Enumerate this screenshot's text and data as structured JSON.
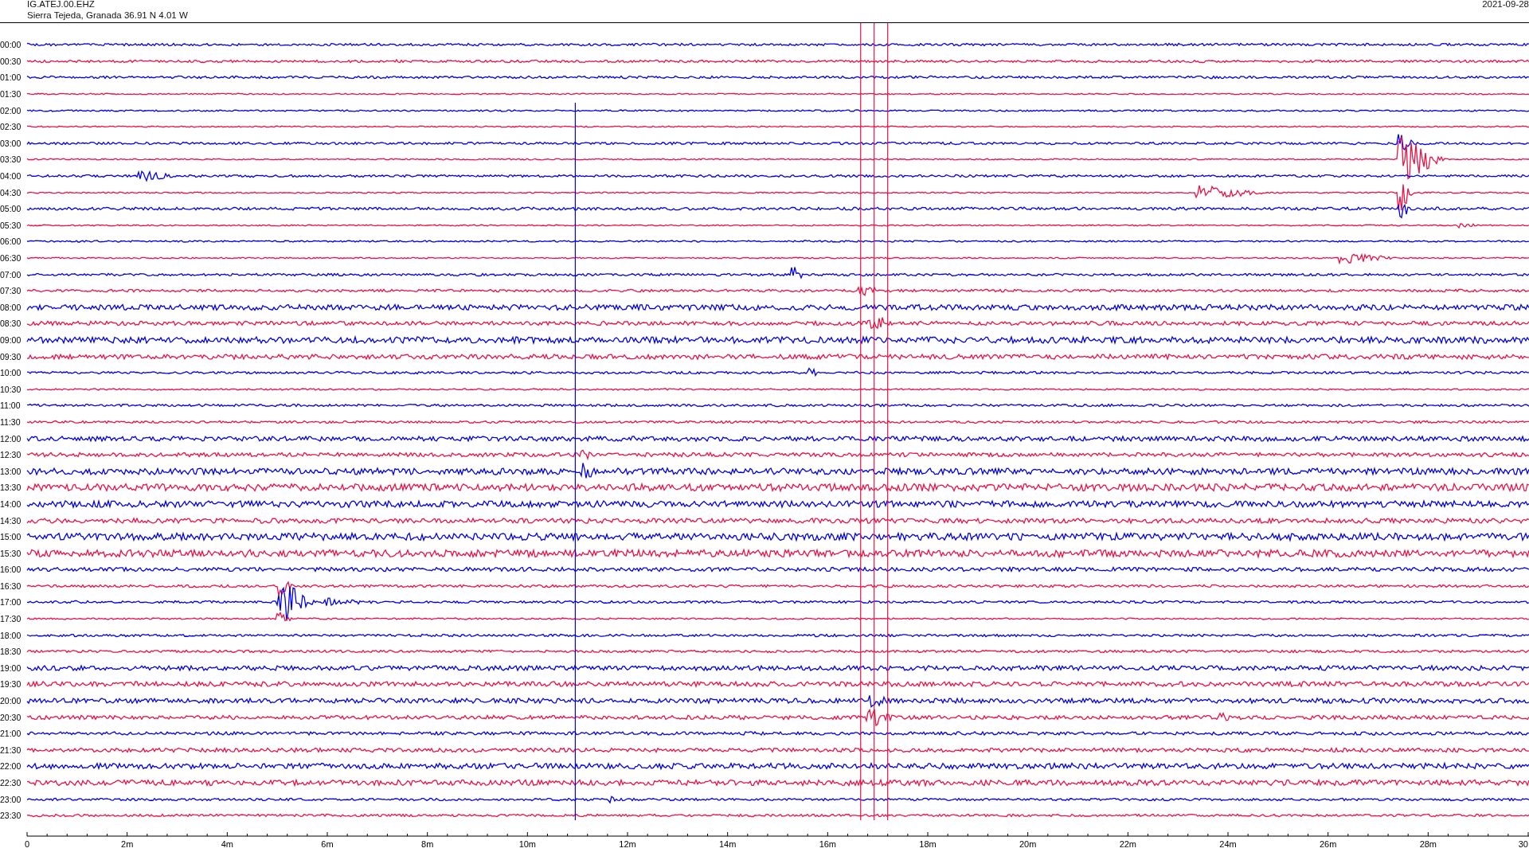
{
  "header": {
    "station": "IG.ATEJ.00.EHZ",
    "location": "Sierra Tejeda, Granada  36.91 N 4.01 W",
    "date": "2021-09-28"
  },
  "rows": [
    {
      "label": "00:00",
      "color": "#0000ee"
    },
    {
      "label": "00:30",
      "color": "#ee1144"
    },
    {
      "label": "01:00",
      "color": "#0000ee"
    },
    {
      "label": "01:30",
      "color": "#ee1144"
    },
    {
      "label": "02:00",
      "color": "#0000ee"
    },
    {
      "label": "02:30",
      "color": "#ee1144"
    },
    {
      "label": "03:00",
      "color": "#0000ee"
    },
    {
      "label": "03:30",
      "color": "#ee1144"
    },
    {
      "label": "04:00",
      "color": "#0000ee"
    },
    {
      "label": "04:30",
      "color": "#ee1144"
    },
    {
      "label": "05:00",
      "color": "#0000ee"
    },
    {
      "label": "05:30",
      "color": "#ee1144"
    },
    {
      "label": "06:00",
      "color": "#0000ee"
    },
    {
      "label": "06:30",
      "color": "#ee1144"
    },
    {
      "label": "07:00",
      "color": "#0000ee"
    },
    {
      "label": "07:30",
      "color": "#ee1144"
    },
    {
      "label": "08:00",
      "color": "#0000ee"
    },
    {
      "label": "08:30",
      "color": "#ee1144"
    },
    {
      "label": "09:00",
      "color": "#0000ee"
    },
    {
      "label": "09:30",
      "color": "#ee1144"
    },
    {
      "label": "10:00",
      "color": "#0000ee"
    },
    {
      "label": "10:30",
      "color": "#ee1144"
    },
    {
      "label": "11:00",
      "color": "#0000ee"
    },
    {
      "label": "11:30",
      "color": "#ee1144"
    },
    {
      "label": "12:00",
      "color": "#0000ee"
    },
    {
      "label": "12:30",
      "color": "#ee1144"
    },
    {
      "label": "13:00",
      "color": "#0000ee"
    },
    {
      "label": "13:30",
      "color": "#ee1144"
    },
    {
      "label": "14:00",
      "color": "#0000ee"
    },
    {
      "label": "14:30",
      "color": "#ee1144"
    },
    {
      "label": "15:00",
      "color": "#0000ee"
    },
    {
      "label": "15:30",
      "color": "#ee1144"
    },
    {
      "label": "16:00",
      "color": "#0000ee"
    },
    {
      "label": "16:30",
      "color": "#ee1144"
    },
    {
      "label": "17:00",
      "color": "#0000ee"
    },
    {
      "label": "17:30",
      "color": "#ee1144"
    },
    {
      "label": "18:00",
      "color": "#0000ee"
    },
    {
      "label": "18:30",
      "color": "#ee1144"
    },
    {
      "label": "19:00",
      "color": "#0000ee"
    },
    {
      "label": "19:30",
      "color": "#ee1144"
    },
    {
      "label": "20:00",
      "color": "#0000ee"
    },
    {
      "label": "20:30",
      "color": "#ee1144"
    },
    {
      "label": "21:00",
      "color": "#0000ee"
    },
    {
      "label": "21:30",
      "color": "#ee1144"
    },
    {
      "label": "22:00",
      "color": "#0000ee"
    },
    {
      "label": "22:30",
      "color": "#ee1144"
    },
    {
      "label": "23:00",
      "color": "#0000ee"
    },
    {
      "label": "23:30",
      "color": "#ee1144"
    }
  ],
  "x_axis": {
    "labels": [
      "0",
      "2m",
      "4m",
      "6m",
      "8m",
      "10m",
      "12m",
      "14m",
      "16m",
      "18m",
      "20m",
      "22m",
      "24m",
      "26m",
      "28m",
      "30"
    ]
  }
}
